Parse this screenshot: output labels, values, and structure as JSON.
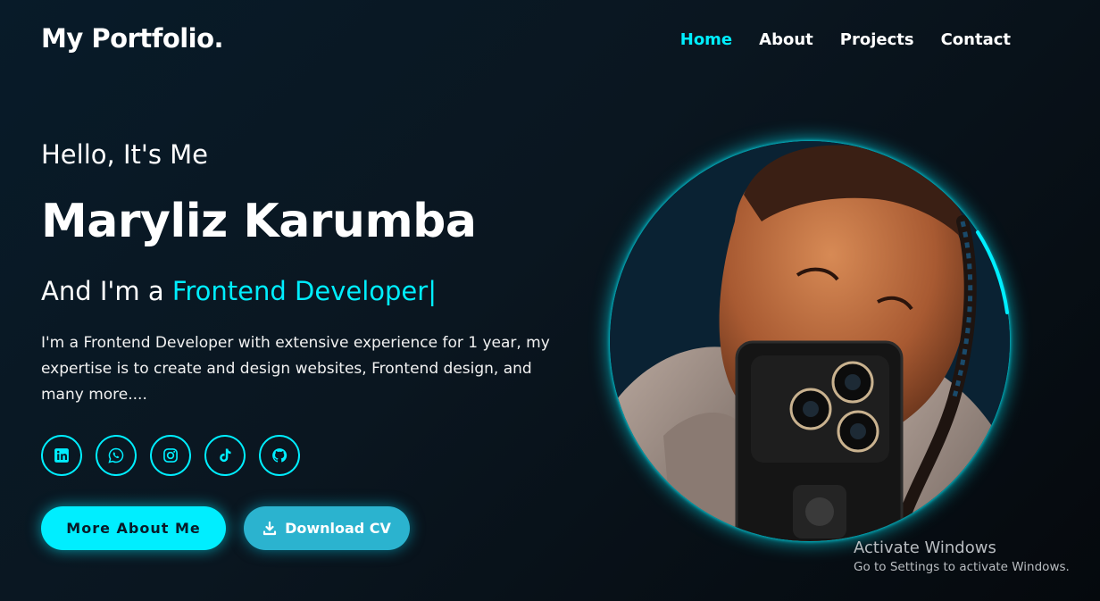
{
  "header": {
    "logo": "My Portfolio.",
    "nav": [
      {
        "label": "Home",
        "active": true
      },
      {
        "label": "About",
        "active": false
      },
      {
        "label": "Projects",
        "active": false
      },
      {
        "label": "Contact",
        "active": false
      }
    ]
  },
  "hero": {
    "greeting": "Hello, It's Me",
    "name": "Maryliz Karumba",
    "role_prefix": "And I'm a ",
    "role_highlight": "Frontend Developer",
    "caret": "|",
    "description": "I'm a Frontend Developer with extensive experience for 1 year, my expertise is to create and design websites, Frontend design, and many more....",
    "socials": [
      {
        "icon": "linkedin-icon"
      },
      {
        "icon": "whatsapp-icon"
      },
      {
        "icon": "instagram-icon"
      },
      {
        "icon": "tiktok-icon"
      },
      {
        "icon": "github-icon"
      }
    ],
    "buttons": {
      "more": "More About Me",
      "download": "Download CV",
      "download_icon": "download-icon"
    }
  },
  "profile_image": {
    "icon": "profile-photo"
  },
  "colors": {
    "accent": "#00eeff",
    "background": "#081b29",
    "button_secondary": "#2bb3cf"
  },
  "watermark": {
    "title": "Activate Windows",
    "subtitle": "Go to Settings to activate Windows."
  }
}
